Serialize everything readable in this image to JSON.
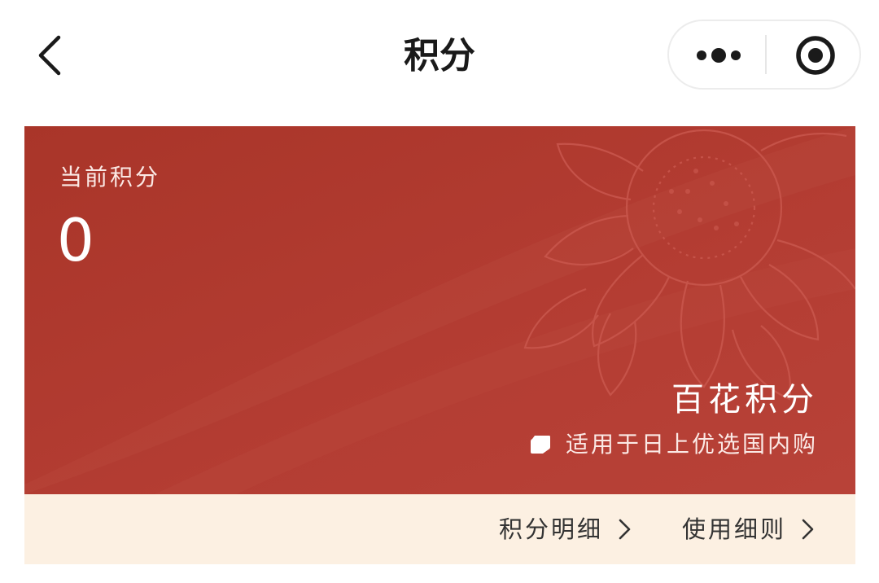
{
  "header": {
    "title": "积分",
    "back_icon": "chevron-left-icon",
    "more_icon": "more-dots-icon",
    "close_icon": "target-circle-icon"
  },
  "points_card": {
    "label": "当前积分",
    "value": "0",
    "brand": "百花积分",
    "scope_text": "适用于日上优选国内购",
    "background_color": "#b03b31"
  },
  "links": {
    "details_label": "积分明细",
    "rules_label": "使用细则",
    "background_color": "#fcf0e2"
  }
}
